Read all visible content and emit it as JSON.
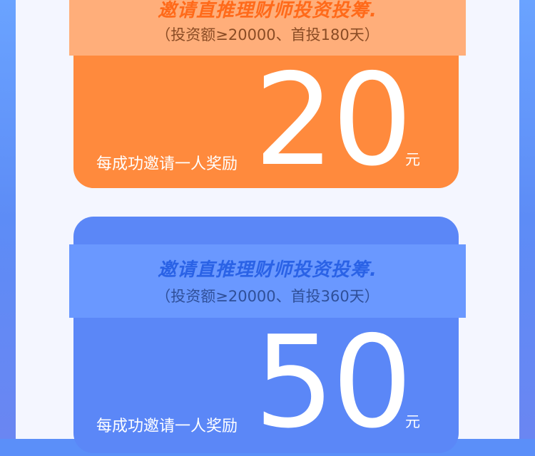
{
  "colors": {
    "page_bg": "#5b8ff9",
    "panel_bg": "#f4f6ff",
    "orange_card": "#ff8a3d",
    "orange_band": "#ffae7a",
    "orange_headline": "#ff6a1a",
    "blue_card": "#5b87f7",
    "blue_band": "#6a98ff",
    "blue_headline": "#2a62e6",
    "white": "#ffffff"
  },
  "cards": [
    {
      "headline": "邀请直推理财师投资投筹.",
      "subline": "（投资额≥20000、首投180天）",
      "reward_label": "每成功邀请一人奖励",
      "reward_value": "20",
      "reward_unit": "元"
    },
    {
      "headline": "邀请直推理财师投资投筹.",
      "subline": "（投资额≥20000、首投360天）",
      "reward_label": "每成功邀请一人奖励",
      "reward_value": "50",
      "reward_unit": "元"
    }
  ]
}
